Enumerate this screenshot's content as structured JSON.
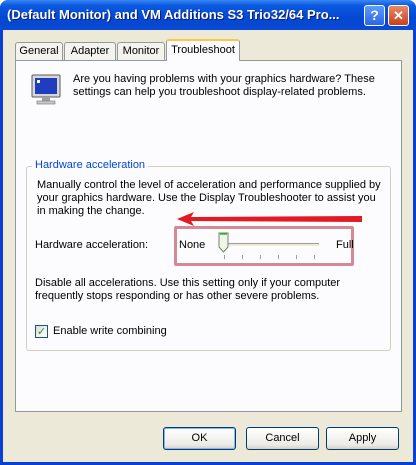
{
  "window": {
    "title": "(Default Monitor) and VM Additions S3 Trio32/64 Pro...",
    "help_label": "?",
    "close_label": "✕"
  },
  "tabs": [
    {
      "label": "General"
    },
    {
      "label": "Adapter"
    },
    {
      "label": "Monitor"
    },
    {
      "label": "Troubleshoot",
      "active": true
    }
  ],
  "troubleshoot": {
    "intro_text": "Are you having problems with your graphics hardware? These settings can help you troubleshoot display-related problems.",
    "group_title": "Hardware acceleration",
    "description": "Manually control the level of acceleration and performance supplied by your graphics hardware. Use the Display Troubleshooter to assist you in making the change.",
    "slider": {
      "label": "Hardware acceleration:",
      "min_label": "None",
      "max_label": "Full",
      "position": 0
    },
    "disable_text": "Disable all accelerations. Use this setting only if your computer frequently stops responding or has other severe problems.",
    "checkbox": {
      "label": "Enable write combining",
      "checked": true
    }
  },
  "buttons": {
    "ok": "OK",
    "cancel": "Cancel",
    "apply": "Apply"
  },
  "colors": {
    "titlebar": "#0a4ad4",
    "dialog_face": "#ece9d8",
    "group_title": "#0046d5",
    "annotation": "#e21a23",
    "highlight_box": "#d28a95"
  },
  "icons": [
    "monitor-icon",
    "help-icon",
    "close-icon",
    "annotation-arrow",
    "slider-thumb-icon"
  ]
}
